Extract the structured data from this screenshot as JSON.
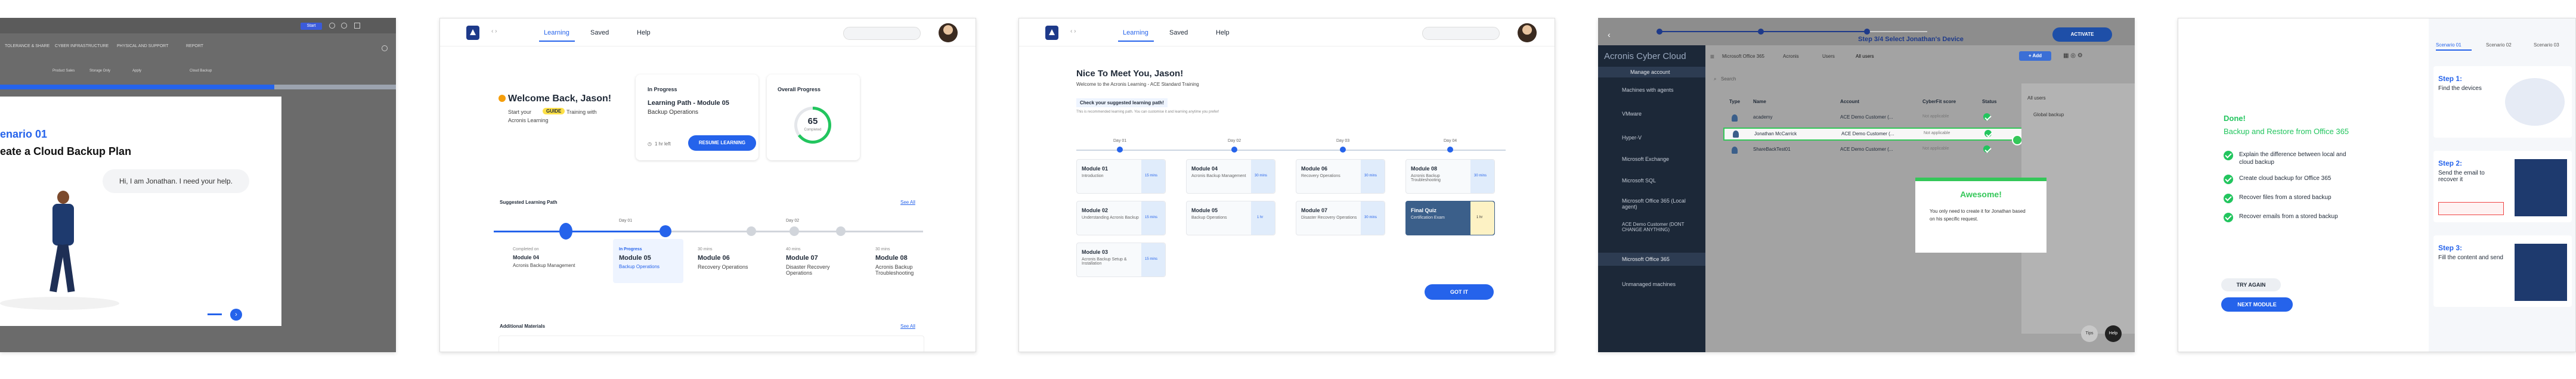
{
  "p1": {
    "tabs": [
      "TOLERANCE & SHARE",
      "CYBER INFRASTRUCTURE",
      "PHYSICAL AND SUPPORT",
      "REPORT"
    ],
    "subtabs": [
      "Product Sales",
      "Storage Only",
      "Apply",
      "Cloud Backup"
    ],
    "header_btn": "Start",
    "scenario": "enario 01",
    "title": "eate a Cloud Backup Plan",
    "speech": "Hi, I am Jonathan. I need your help."
  },
  "p2": {
    "nav": [
      "Learning",
      "Saved",
      "Help"
    ],
    "welcome": "Welcome Back, Jason!",
    "start_text": "Start your",
    "start_badge": "GUIDE",
    "start_text2": "Training with",
    "start_text3": "Acronis Learning",
    "in_progress_label": "In Progress",
    "path_title": "Learning Path - Module 05",
    "path_sub": "Backup Operations",
    "path_time": "1 hr left",
    "resume": "RESUME LEARNING",
    "overall_label": "Overall Progress",
    "overall_value": "65",
    "overall_unit": "Completed",
    "overall_percent": 65,
    "suggested": "Suggested Learning Path",
    "see_all": "See All",
    "steps": [
      {
        "meta": "Completed on",
        "title": "Module 04",
        "sub": "Acronis Backup Management",
        "tag": ""
      },
      {
        "meta": "In Progress",
        "title": "Module 05",
        "sub": "Backup Operations",
        "tag": "Day 01"
      },
      {
        "meta": "30 mins",
        "title": "Module 06",
        "sub": "Recovery Operations",
        "tag": ""
      },
      {
        "meta": "40 mins",
        "title": "Module 07",
        "sub": "Disaster Recovery Operations",
        "tag": "Day 02"
      },
      {
        "meta": "30 mins",
        "title": "Module 08",
        "sub": "Acronis Backup Troubleshooting",
        "tag": ""
      }
    ],
    "additional": "Additional Materials",
    "see_all2": "See All"
  },
  "p3": {
    "nav": [
      "Learning",
      "Saved",
      "Help"
    ],
    "heading": "Nice To Meet You, Jason!",
    "sub": "Welcome to the Acronis Learning - ACE Standard Training",
    "check_title": "Check your suggested learning path!",
    "check_sub": "This is recommended learning path. You can customise it and learning anytime you prefer!",
    "days": [
      "Day 01",
      "Day 02",
      "Day 03",
      "Day 04"
    ],
    "modules": [
      {
        "title": "Module 01",
        "sub": "Introduction",
        "time": "15 mins"
      },
      {
        "title": "Module 04",
        "sub": "Acronis Backup Management",
        "time": "30 mins"
      },
      {
        "title": "Module 06",
        "sub": "Recovery Operations",
        "time": "30 mins"
      },
      {
        "title": "Module 08",
        "sub": "Acronis Backup Troubleshooting",
        "time": "30 mins"
      },
      {
        "title": "Module 02",
        "sub": "Understanding Acronis Backup",
        "time": "15 mins"
      },
      {
        "title": "Module 05",
        "sub": "Backup Operations",
        "time": "1 hr"
      },
      {
        "title": "Module 07",
        "sub": "Disaster Recovery Operations",
        "time": "30 mins"
      },
      {
        "title": "Final Quiz",
        "sub": "Certification Exam",
        "time": "1 hr"
      },
      {
        "title": "Module 03",
        "sub": "Acronis Backup Setup & Installation",
        "time": "15 mins"
      }
    ],
    "got_it": "GOT IT"
  },
  "p4": {
    "step_text": "Step 3/4 Select Jonathan's Device",
    "activate": "ACTIVATE",
    "brand": "Acronis Cyber Cloud",
    "menu": [
      "Manage account",
      "Machines with agents",
      "VMware",
      "Hyper-V",
      "Microsoft Exchange",
      "Microsoft SQL",
      "Microsoft Office 365 (Local agent)",
      "ACE Demo Customer (DONT CHANGE ANYTHING)",
      "Microsoft Office 365",
      "Unmanaged machines"
    ],
    "breadcrumb": [
      "Microsoft Office 365",
      "Acronis",
      "Users",
      "All users"
    ],
    "add": "+ Add",
    "search": "Search",
    "cols": [
      "Type",
      "Name",
      "Account",
      "CyberFit score",
      "Status"
    ],
    "rows": [
      {
        "name": "academy",
        "account": "ACE Demo Customer (...",
        "score": "Not applicable"
      },
      {
        "name": "Jonathan McCarrick",
        "account": "ACE Demo Customer (...",
        "score": "Not applicable"
      },
      {
        "name": "ShareBackTest01",
        "account": "ACE Demo Customer (...",
        "score": "Not applicable"
      }
    ],
    "all_users": "All users",
    "global_backup": "Global backup",
    "awesome_title": "Awesome!",
    "awesome_body": "You only need to create it for Jonathan based on his specific request.",
    "tips": "Tips",
    "help": "Help"
  },
  "p5": {
    "done": "Done!",
    "title": "Backup and Restore from Office 365",
    "items": [
      "Explain the difference between local and cloud backup",
      "Create cloud backup for Office 365",
      "Recover files from a stored backup",
      "Recover emails from a stored backup"
    ],
    "try_again": "TRY AGAIN",
    "next": "NEXT MODULE",
    "tabs": [
      "Scenario 01",
      "Scenario 02",
      "Scenario 03"
    ],
    "steps": [
      {
        "title": "Step 1:",
        "desc": "Find the devices"
      },
      {
        "title": "Step 2:",
        "desc": "Send the email to recover it"
      },
      {
        "title": "Step 3:",
        "desc": "Fill the content and send"
      }
    ]
  }
}
